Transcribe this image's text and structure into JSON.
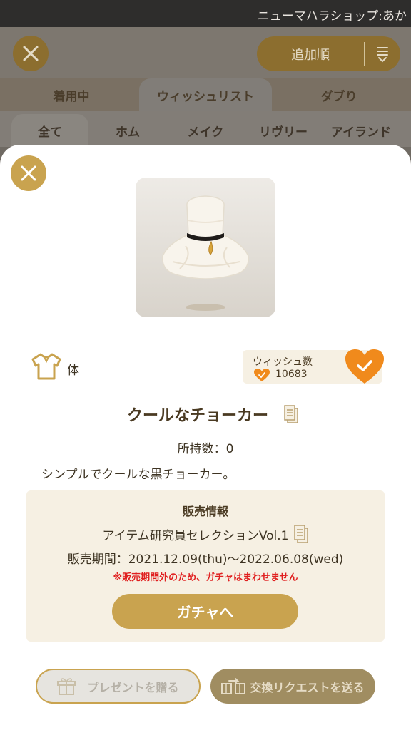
{
  "status_bar": {
    "shop_name": "ニューマハラショップ:あか"
  },
  "background": {
    "sort_label": "追加順",
    "tabs": [
      "着用中",
      "ウィッシュリスト",
      "ダブり"
    ],
    "subtabs": [
      "全て",
      "ホム",
      "メイク",
      "リヴリー",
      "アイランド"
    ]
  },
  "item": {
    "category": "体",
    "name": "クールなチョーカー",
    "owned_label": "所持数：0",
    "description": "シンプルでクールな黒チョーカー。"
  },
  "wish": {
    "title": "ウィッシュ数",
    "count": "10683"
  },
  "sale": {
    "title": "販売情報",
    "selection": "アイテム研究員セレクションVol.1",
    "period": "販売期間：2021.12.09(thu)〜2022.06.08(wed)",
    "warning": "※販売期間外のため、ガチャはまわせません",
    "gacha_button": "ガチャへ"
  },
  "footer": {
    "present_button": "プレゼントを贈る",
    "trade_button": "交換リクエストを送る"
  },
  "colors": {
    "accent_gold": "#c9a34f",
    "wish_orange": "#f08a1c",
    "warning_red": "#e02020",
    "panel_cream": "#f6f0e3"
  },
  "icons": [
    "close-icon",
    "sort-icon",
    "shirt-icon",
    "heart-icon",
    "check-icon",
    "copy-icon",
    "gift-icon",
    "exchange-icon"
  ]
}
